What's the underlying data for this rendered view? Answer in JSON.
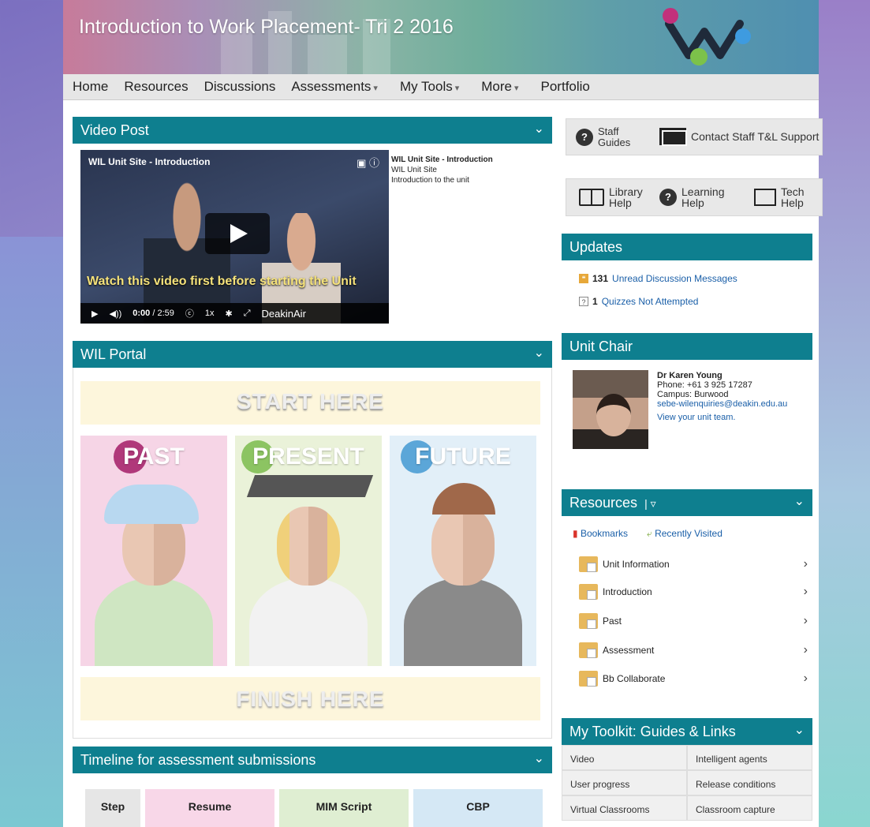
{
  "site": {
    "title": "Introduction to Work Placement- Tri 2 2016"
  },
  "nav": {
    "items": [
      {
        "label": "Home",
        "has_caret": false
      },
      {
        "label": "Resources",
        "has_caret": false
      },
      {
        "label": "Discussions",
        "has_caret": false
      },
      {
        "label": "Assessments",
        "has_caret": true
      },
      {
        "label": "My Tools",
        "has_caret": true
      },
      {
        "label": "More",
        "has_caret": true
      },
      {
        "label": "Portfolio",
        "has_caret": false
      }
    ]
  },
  "video_post": {
    "heading": "Video Post",
    "player_title": "WIL Unit Site - Introduction",
    "caption": "Watch this video first before starting the Unit",
    "time_current": "0:00",
    "time_total": "/ 2:59",
    "speed": "1x",
    "brand": "DeakinAir",
    "meta_title": "WIL Unit Site - Introduction",
    "meta_line1": "WIL Unit Site",
    "meta_line2": "Introduction to the unit"
  },
  "wil_portal": {
    "heading": "WIL Portal",
    "start_label": "START HERE",
    "finish_label": "FINISH HERE",
    "tiles": [
      {
        "label": "PAST",
        "color": "#f6d5e6",
        "circle": "#b0387a"
      },
      {
        "label": "PRESENT",
        "color": "#eaf2d9",
        "circle": "#8cc462"
      },
      {
        "label": "FUTURE",
        "color": "#e2eff8",
        "circle": "#5ba6d8"
      }
    ]
  },
  "timeline": {
    "heading": "Timeline for assessment submissions",
    "columns": [
      {
        "label": "Step",
        "color": "#e6e6e6"
      },
      {
        "label": "Resume",
        "color": "#f8d7e8"
      },
      {
        "label": "MIM Script",
        "color": "#dfeed2"
      },
      {
        "label": "CBP",
        "color": "#d5e8f5"
      }
    ]
  },
  "help": {
    "staff_guides": "Staff Guides",
    "contact": "Contact Staff T&L Support",
    "library": "Library Help",
    "learning": "Learning Help",
    "tech": "Tech Help"
  },
  "updates": {
    "heading": "Updates",
    "items": [
      {
        "count": "131",
        "label": "Unread Discussion Messages",
        "icon": "quote-icon"
      },
      {
        "count": "1",
        "label": "Quizzes Not Attempted",
        "icon": "quiz-icon"
      }
    ]
  },
  "unit_chair": {
    "heading": "Unit Chair",
    "name": "Dr Karen Young",
    "phone": "Phone: +61 3 925 17287",
    "campus": "Campus: Burwood",
    "email": "sebe-wilenquiries@deakin.edu.au",
    "team_link": "View your unit team."
  },
  "resources": {
    "heading": "Resources",
    "bookmarks": "Bookmarks",
    "recent": "Recently Visited",
    "items": [
      "Unit Information",
      "Introduction",
      "Past",
      "Assessment",
      "Bb Collaborate"
    ]
  },
  "toolkit": {
    "heading": "My Toolkit: Guides & Links",
    "items": [
      "Video",
      "Intelligent agents",
      "User progress",
      "Release conditions",
      "Virtual Classrooms",
      "Classroom capture"
    ]
  },
  "colors": {
    "accent": "#0e7f8f"
  }
}
